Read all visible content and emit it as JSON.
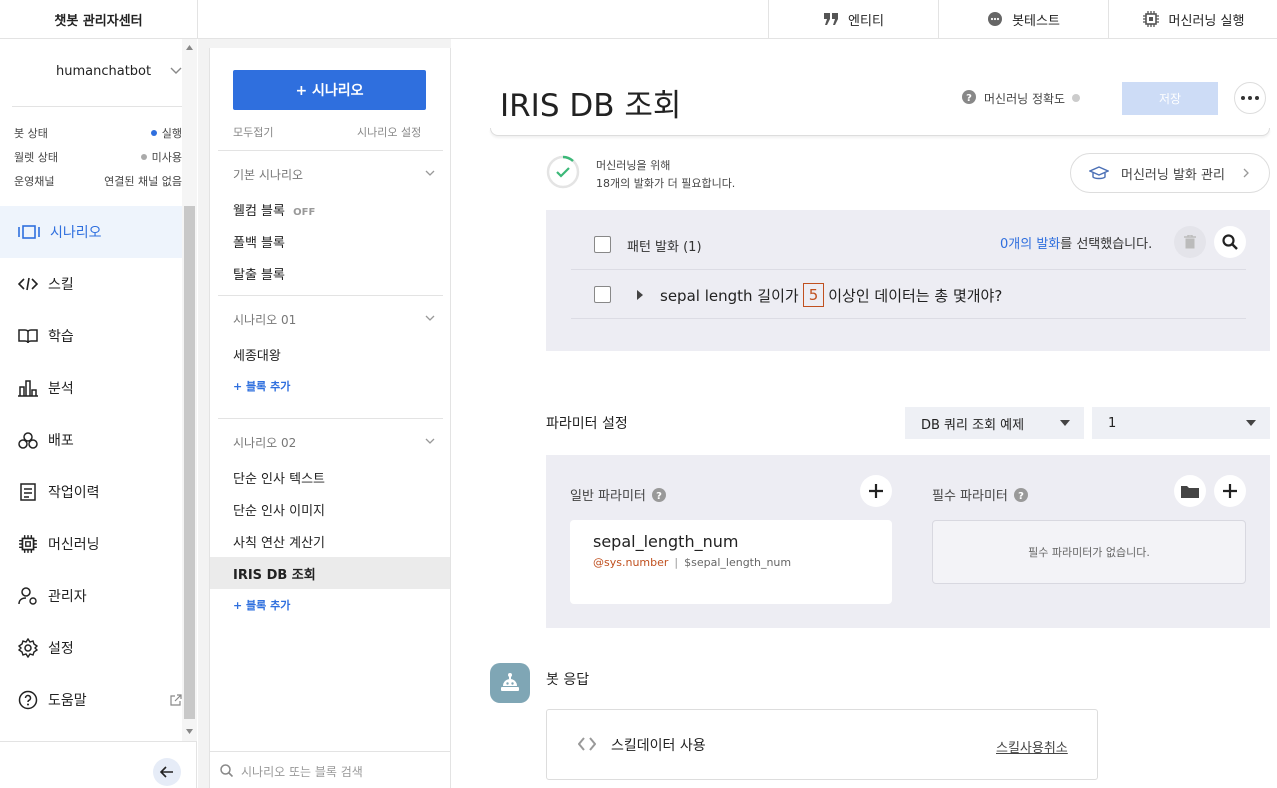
{
  "topbar": {
    "brand": "챗봇 관리자센터",
    "entity_label": "엔티티",
    "bottest_label": "봇테스트",
    "ml_run_label": "머신러닝 실행"
  },
  "sidebar": {
    "bot_name": "humanchatbot",
    "status": [
      {
        "label": "봇 상태",
        "value": "실행",
        "dot": "#2f6fde"
      },
      {
        "label": "월렛 상태",
        "value": "미사용",
        "dot": "#aaaaaa"
      },
      {
        "label": "운영채널",
        "value": "연결된 채널 없음",
        "dot": ""
      }
    ],
    "items": [
      {
        "label": "시나리오",
        "icon": "scenario-icon"
      },
      {
        "label": "스킬",
        "icon": "code-icon"
      },
      {
        "label": "학습",
        "icon": "book-icon"
      },
      {
        "label": "분석",
        "icon": "bar-chart-icon"
      },
      {
        "label": "배포",
        "icon": "deploy-icon"
      },
      {
        "label": "작업이력",
        "icon": "history-icon"
      },
      {
        "label": "머신러닝",
        "icon": "chip-icon"
      },
      {
        "label": "관리자",
        "icon": "admin-icon"
      },
      {
        "label": "설정",
        "icon": "gear-icon"
      },
      {
        "label": "도움말",
        "icon": "help-icon"
      }
    ]
  },
  "panel": {
    "add_scenario_label": "+ 시나리오",
    "collapse_all": "모두접기",
    "scenario_settings": "시나리오 설정",
    "sections": [
      {
        "title": "기본 시나리오",
        "items": [
          "웰컴 블록",
          "폴백 블록",
          "탈출 블록"
        ],
        "off_badge": "OFF"
      },
      {
        "title": "시나리오 01",
        "items": [
          "세종대왕"
        ],
        "add_block": "+ 블록 추가"
      },
      {
        "title": "시나리오 02",
        "items": [
          "단순 인사 텍스트",
          "단순 인사 이미지",
          "사칙 연산 계산기",
          "IRIS DB 조회"
        ],
        "add_block": "+ 블록 추가"
      }
    ],
    "search_placeholder": "시나리오 또는 블록 검색"
  },
  "main": {
    "title": "IRIS DB 조회",
    "ml_accuracy_label": "머신러닝 정확도",
    "save_label": "저장",
    "ml_notice_line1": "머신러닝을 위해",
    "ml_notice_count": "18",
    "ml_notice_line2": "개의 발화가 더 필요합니다.",
    "ml_manage_label": "머신러닝 발화 관리",
    "pattern": {
      "header": "패턴 발화 (1)",
      "selected_count": "0개의 발화",
      "selected_suffix": "를 선택했습니다.",
      "utterance_before": "sepal length 길이가",
      "utterance_entity": "5",
      "utterance_after": "이상인 데이터는 총 몇개야?"
    },
    "params": {
      "title": "파라미터 설정",
      "query_select": "DB 쿼리 조회 예제",
      "num_select": "1",
      "general_label": "일반 파라미터",
      "required_label": "필수 파라미터",
      "param_name": "sepal_length_num",
      "param_entity": "@sys.number",
      "param_separator": "|",
      "param_var": "$sepal_length_num",
      "no_required": "필수 파라미터가 없습니다."
    },
    "bot_response": {
      "title": "봇 응답",
      "skill_label": "스킬데이터 사용",
      "skill_cancel": "스킬사용취소"
    }
  },
  "colors": {
    "accent": "#2f6fde",
    "entity": "#c0501f",
    "check": "#3cb878"
  }
}
